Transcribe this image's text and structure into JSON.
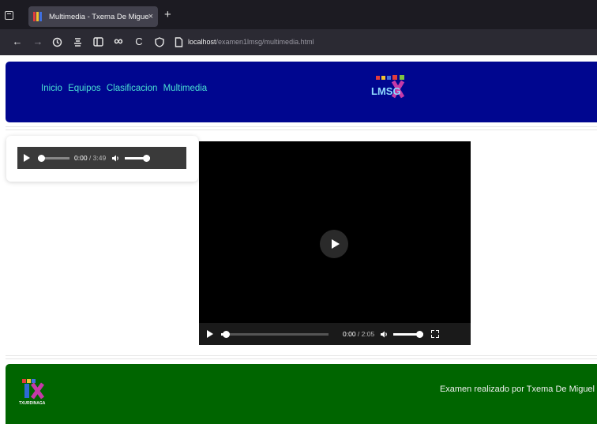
{
  "browser": {
    "tab_title": "Multimedia - Txema De Miguel",
    "tab_close": "×",
    "new_tab": "+",
    "url_host": "localhost",
    "url_path": "/examen1lmsg/multimedia.html"
  },
  "header": {
    "menu": [
      "Inicio",
      "Equipos",
      "Clasificacion",
      "Multimedia"
    ],
    "logo_text": "LMSG",
    "logo_mark": "TX"
  },
  "audio": {
    "current": "0:00",
    "duration": "3:49",
    "progress": 0.05,
    "volume": 1.0
  },
  "video": {
    "current": "0:00",
    "duration": "2:05",
    "progress": 0.05,
    "volume": 1.0
  },
  "footer": {
    "logo_mark": "TX",
    "logo_label": "TXURDINAGA",
    "credit": "Examen realizado por Txema De Miguel"
  },
  "colors": {
    "header_bg": "#00068f",
    "menu_text": "#49e1d3",
    "footer_bg": "#006500"
  }
}
